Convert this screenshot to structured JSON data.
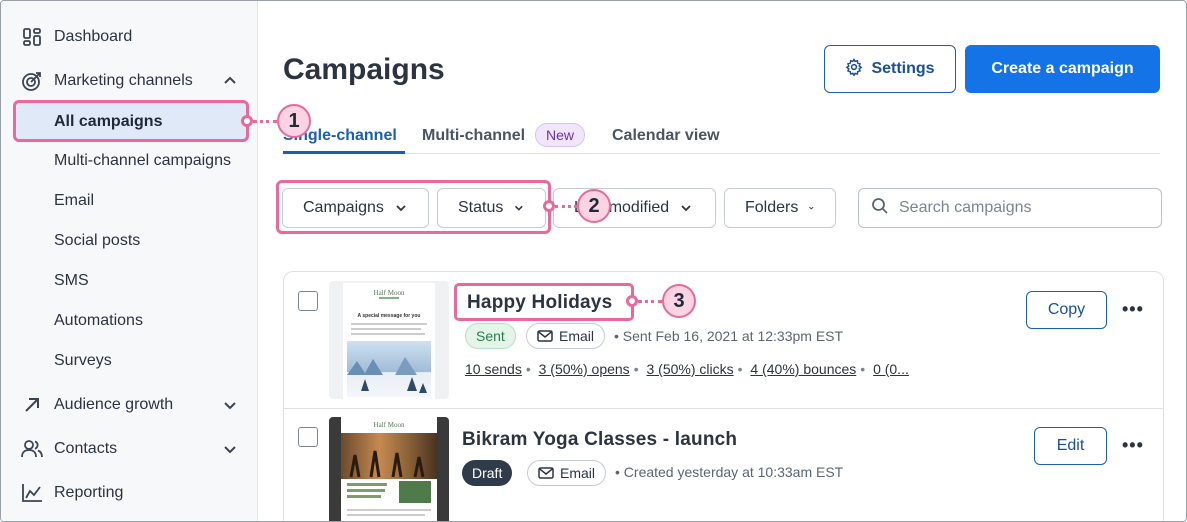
{
  "sidebar": {
    "items": [
      {
        "label": "Dashboard",
        "icon": "dashboard-icon"
      },
      {
        "label": "Marketing channels",
        "icon": "target-icon",
        "expanded": true
      },
      {
        "label": "Audience growth",
        "icon": "arrow-up-right-icon"
      },
      {
        "label": "Contacts",
        "icon": "contacts-icon"
      },
      {
        "label": "Reporting",
        "icon": "reporting-icon"
      }
    ],
    "subitems": [
      "All campaigns",
      "Multi-channel campaigns",
      "Email",
      "Social posts",
      "SMS",
      "Automations",
      "Surveys"
    ],
    "active": "All campaigns"
  },
  "callouts": [
    "1",
    "2",
    "3"
  ],
  "header": {
    "title": "Campaigns",
    "settings_label": "Settings",
    "create_label": "Create a campaign"
  },
  "tabs": {
    "single": "Single-channel",
    "multi": "Multi-channel",
    "new_badge": "New",
    "calendar": "Calendar view"
  },
  "filters": {
    "campaigns": "Campaigns",
    "status": "Status",
    "modified": "Last modified",
    "folders": "Folders",
    "search_placeholder": "Search campaigns"
  },
  "campaigns": [
    {
      "title": "Happy Holidays",
      "status": "Sent",
      "channel": "Email",
      "meta": "• Sent Feb 16, 2021 at 12:33pm EST",
      "stats": [
        "10 sends",
        "3 (50%) opens",
        "3 (50%) clicks",
        "4 (40%) bounces",
        "0 (0..."
      ],
      "action": "Copy",
      "thumb_heading": "A special message for you",
      "thumb_brand": "Half Moon"
    },
    {
      "title": "Bikram Yoga Classes - launch",
      "status": "Draft",
      "channel": "Email",
      "meta": "• Created yesterday at 10:33am EST",
      "action": "Edit",
      "thumb_brand": "Half Moon"
    }
  ],
  "more_label": "•••",
  "colors": {
    "accent": "#1473e6",
    "callout": "#e8699a",
    "sent": "#2e7d4f",
    "draft": "#2f3a4a"
  }
}
